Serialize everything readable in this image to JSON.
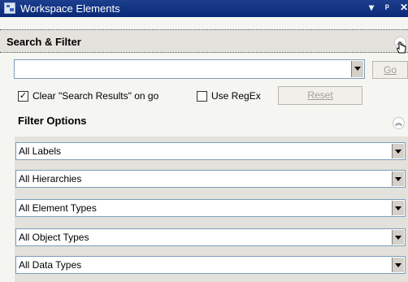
{
  "window": {
    "title": "Workspace Elements",
    "controls": [
      "▾",
      "ᵖ",
      "✕"
    ]
  },
  "search_filter": {
    "header": "Search & Filter",
    "search_value": "",
    "go_label": "Go",
    "clear_checkbox": {
      "label": "Clear \"Search Results\" on go",
      "checked": true
    },
    "regex_checkbox": {
      "label": "Use RegEx",
      "checked": false
    },
    "reset_label": "Reset"
  },
  "filter_options": {
    "header": "Filter Options",
    "filters": [
      "All Labels",
      "All Hierarchies",
      "All Element Types",
      "All Object Types",
      "All Data Types"
    ]
  },
  "colors": {
    "titlebar": "#0a2a78",
    "panel": "#e3e1db",
    "field_border": "#7f9db9"
  }
}
